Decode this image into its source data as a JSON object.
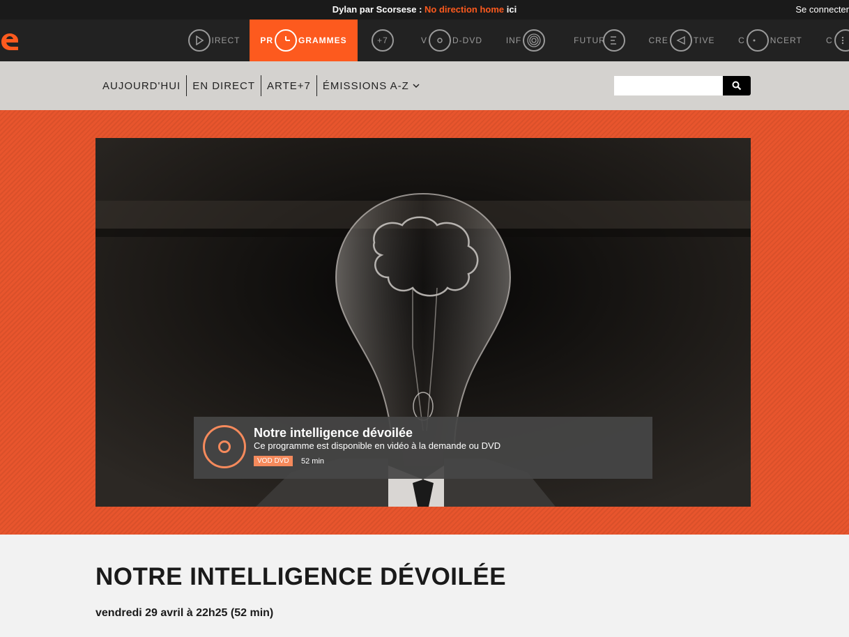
{
  "topbar": {
    "promo_prefix": "Dylan par Scorsese : ",
    "promo_link": "No direction home",
    "promo_suffix": " ici",
    "login": "Se connecter"
  },
  "nav": {
    "items": [
      {
        "icon": "play-icon",
        "pre": "",
        "post": "IRECT"
      },
      {
        "icon": "clock-icon",
        "pre": "PR",
        "post": "GRAMMES"
      },
      {
        "icon": "plus7-icon",
        "pre": "",
        "post": "",
        "center": "+7"
      },
      {
        "icon": "disc-icon",
        "pre": "V",
        "post": "D-DVD"
      },
      {
        "icon": "radar-icon",
        "pre": "INF",
        "post": ""
      },
      {
        "icon": "future-icon",
        "pre": "FUTUR",
        "post": ""
      },
      {
        "icon": "creative-icon",
        "pre": "CRE",
        "post": "TIVE"
      },
      {
        "icon": "concert-icon",
        "pre": "C",
        "post": "NCERT"
      },
      {
        "icon": "more-icon",
        "pre": "C",
        "post": ""
      }
    ],
    "active_index": 1
  },
  "subnav": {
    "links": [
      "AUJOURD'HUI",
      "EN DIRECT",
      "ARTE+7",
      "ÉMISSIONS A-Z"
    ],
    "search_placeholder": ""
  },
  "hero": {
    "title": "Notre intelligence dévoilée",
    "subtitle": "Ce programme est disponible en vidéo à la demande ou DVD",
    "badge": "VOD DVD",
    "duration": "52 min"
  },
  "page": {
    "title": "NOTRE INTELLIGENCE DÉVOILÉE",
    "airtime": "vendredi 29 avril à 22h25 (52 min)"
  },
  "colors": {
    "accent": "#fd5a1e",
    "hero_bg": "#e8552d",
    "badge": "#f58a5c"
  }
}
